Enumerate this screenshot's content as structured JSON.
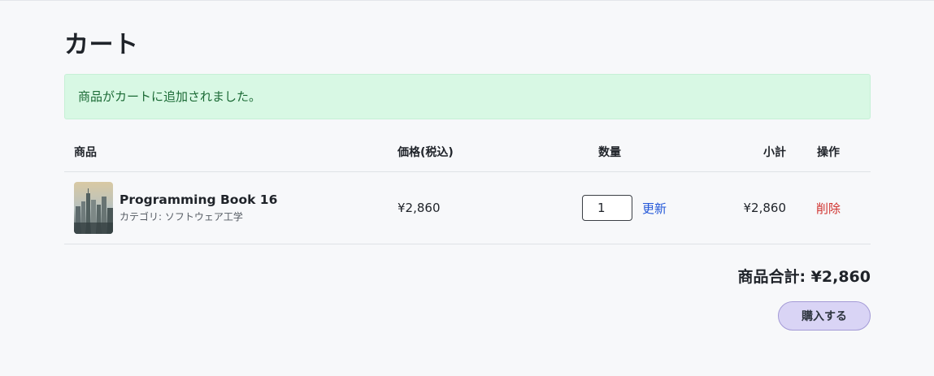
{
  "page": {
    "title": "カート"
  },
  "alert": {
    "message": "商品がカートに追加されました。"
  },
  "table": {
    "headers": {
      "item": "商品",
      "price": "価格(税込)",
      "quantity": "数量",
      "subtotal": "小計",
      "action": "操作"
    },
    "rows": [
      {
        "title": "Programming Book 16",
        "category": "カテゴリ: ソフトウェア工学",
        "price": "¥2,860",
        "quantity": "1",
        "update_label": "更新",
        "subtotal": "¥2,860",
        "delete_label": "削除"
      }
    ]
  },
  "summary": {
    "total_text": "商品合計: ¥2,860"
  },
  "actions": {
    "buy_label": "購入する"
  },
  "colors": {
    "alert_bg": "#d8f8e4",
    "link": "#2357d8",
    "delete": "#d0312d",
    "buy_bg": "#d9d4f5"
  }
}
